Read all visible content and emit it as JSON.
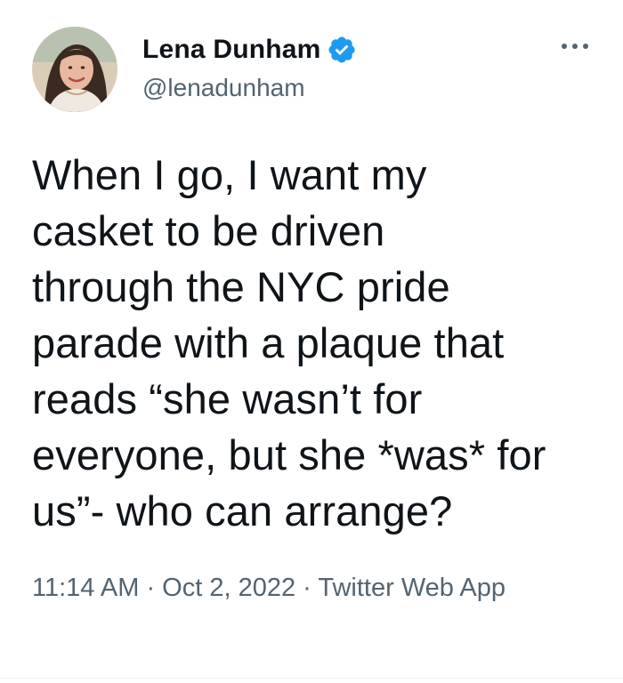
{
  "tweet": {
    "author": {
      "display_name": "Lena Dunham",
      "handle": "@lenadunham",
      "verified_icon": "verified-badge-icon",
      "avatar_icon": "profile-photo"
    },
    "more_icon": "more-options-icon",
    "text": "When I go, I want my\ncasket to be driven\nthrough the NYC pride\nparade with a plaque that\nreads “she wasn’t for\neveryone, but she *was* for\nus”- who can arrange?",
    "meta": {
      "time": "11:14 AM",
      "separator": " · ",
      "date": "Oct 2, 2022",
      "source": "Twitter Web App"
    }
  },
  "colors": {
    "text": "#0f1419",
    "secondary": "#536471",
    "verified": "#1d9bf0",
    "divider": "#eff3f4"
  }
}
